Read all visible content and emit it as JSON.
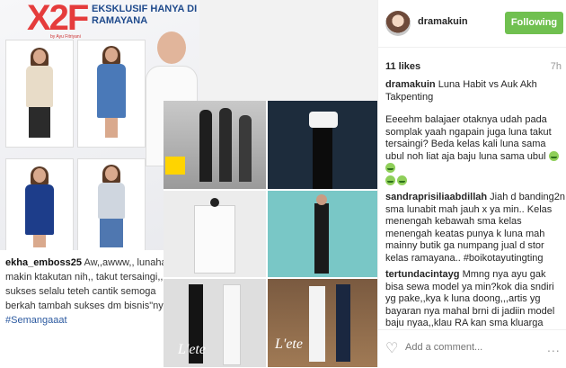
{
  "photo": {
    "flyer": {
      "logo": "X2F",
      "logo_sub": "by Ayu Fitriyani",
      "title": "EKSKLUSIF HANYA DI RAMAYANA"
    },
    "overlay_comment": {
      "user": "ekha_emboss25",
      "lines": [
        "Aw,,awww,, lunahabit",
        "makin ktakutan nih,, takut tersaingi,,",
        "sukses selalu teteh cantik semoga",
        "berkah tambah sukses dm bisnis\"nya",
        "#Semangaaat"
      ]
    },
    "collage_labels": [
      "L'ete",
      "L'ete"
    ]
  },
  "post": {
    "username": "dramakuin",
    "follow_label": "Following",
    "likes": "11 likes",
    "age": "7h",
    "comments": [
      {
        "user": "dramakuin",
        "text": "Luna Habit vs Auk Akh Takpenting"
      },
      {
        "user": "",
        "text": "Eeeehm balajaer otaknya udah pada somplak yaah ngapain juga luna takut tersaingi? Beda kelas kali luna sama ubul noh liat aja baju luna sama ubul"
      },
      {
        "user": "sandraprisiliaabdillah",
        "text": "Jiah d banding2n sma lunabit mah jauh x ya min.. Kelas menengah kebawah sma kelas menengah keatas punya k luna mah mainny butik ga numpang jual d stor kelas ramayana.. #boikotayutingting"
      },
      {
        "user": "tertundacintayg",
        "text": "Mmng nya ayu gak bisa sewa model ya min?kok dia sndiri yg pake,,kya k luna doong,,,artis yg bayaran nya mahal brni di jadiin model baju nyaa,,klau RA kan sma kluarga nya,,pernah jga ada model nyaa,,lah si ubul kok gak ajak kluarga sih?"
      }
    ],
    "add_comment_placeholder": "Add a comment...",
    "more_label": "..."
  }
}
